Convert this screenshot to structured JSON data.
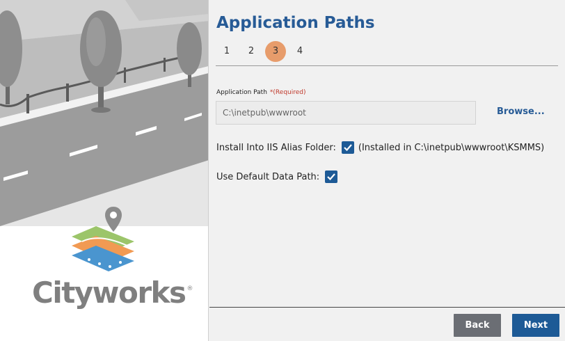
{
  "wizard": {
    "title": "Application Paths",
    "steps": [
      {
        "label": "1",
        "active": false
      },
      {
        "label": "2",
        "active": false
      },
      {
        "label": "3",
        "active": true
      },
      {
        "label": "4",
        "active": false
      }
    ]
  },
  "application_path": {
    "label": "Application Path",
    "required_text": "*(Required)",
    "value": "C:\\inetpub\\wwwroot",
    "browse_label": "Browse..."
  },
  "options": {
    "iis_alias": {
      "label": "Install Into IIS Alias Folder:",
      "checked": true,
      "note": "(Installed in C:\\inetpub\\wwwroot\\KSMMS)"
    },
    "default_data_path": {
      "label": "Use Default Data Path:",
      "checked": true
    }
  },
  "buttons": {
    "back_label": "Back",
    "next_label": "Next"
  },
  "brand": {
    "wordmark": "Cityworks",
    "registered": "®"
  },
  "colors": {
    "accent_blue": "#1d5a96",
    "title_blue": "#275b96",
    "active_step": "#e79c6b",
    "back_button": "#6b6e74"
  }
}
